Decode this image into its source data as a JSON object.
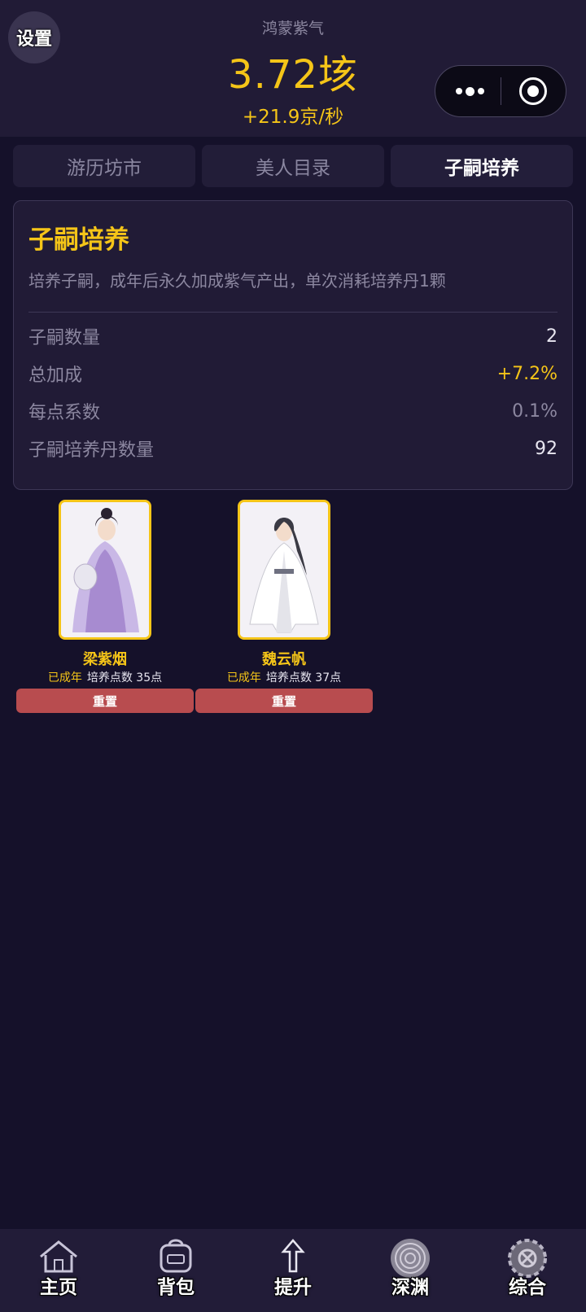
{
  "header": {
    "settings_label": "设置",
    "resource_label": "鸿蒙紫气",
    "resource_value": "3.72垓",
    "resource_rate": "+21.9京/秒"
  },
  "tabs": [
    {
      "label": "游历坊市",
      "active": false
    },
    {
      "label": "美人目录",
      "active": false
    },
    {
      "label": "子嗣培养",
      "active": true
    }
  ],
  "panel": {
    "title": "子嗣培养",
    "description": "培养子嗣，成年后永久加成紫气产出，单次消耗培养丹1颗",
    "stats": [
      {
        "label": "子嗣数量",
        "value": "2"
      },
      {
        "label": "总加成",
        "value": "+7.2%"
      },
      {
        "label": "每点系数",
        "value": "0.1%"
      },
      {
        "label": "子嗣培养丹数量",
        "value": "92"
      }
    ]
  },
  "children": [
    {
      "name": "梁紫烟",
      "status": "已成年",
      "points": "培养点数 35点",
      "reset_label": "重置"
    },
    {
      "name": "魏云帆",
      "status": "已成年",
      "points": "培养点数 37点",
      "reset_label": "重置"
    }
  ],
  "bottom_nav": [
    {
      "label": "主页",
      "icon": "house-icon"
    },
    {
      "label": "背包",
      "icon": "backpack-icon"
    },
    {
      "label": "提升",
      "icon": "arrow-up-icon"
    },
    {
      "label": "深渊",
      "icon": "vortex-icon"
    },
    {
      "label": "综合",
      "icon": "gear-icon"
    }
  ],
  "colors": {
    "accent_gold": "#f5c518",
    "background": "#15112a",
    "panel": "#211b36",
    "reset_button": "#b84c4f"
  }
}
